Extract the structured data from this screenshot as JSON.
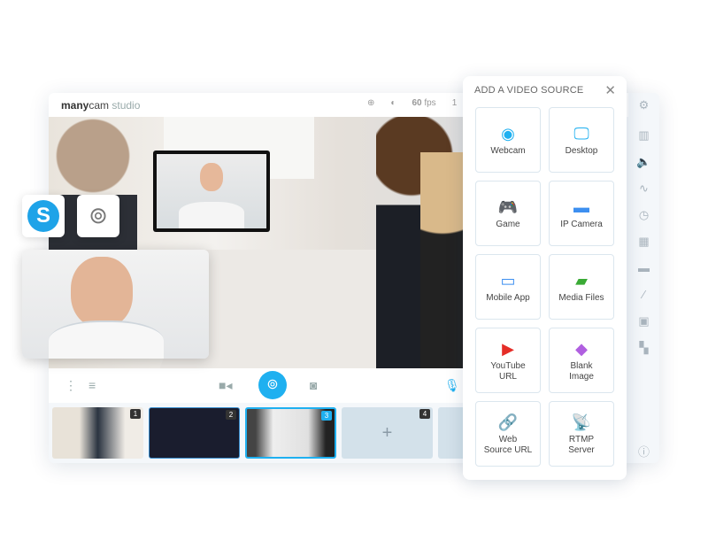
{
  "app": {
    "brand_bold": "many",
    "brand_light": "cam",
    "product": " studio",
    "fps_value": "60",
    "fps_unit": " fps",
    "extra": "1"
  },
  "header_icons": [
    "zoom-in-icon",
    "brightness-icon"
  ],
  "controls": {
    "left": [
      "more-vertical-icon",
      "playlist-icon"
    ],
    "center": [
      "video-camera-icon",
      "broadcast-icon",
      "camera-snapshot-icon"
    ],
    "right": [
      "microphone-icon"
    ]
  },
  "thumbnails": [
    {
      "number": "1",
      "content": "photo"
    },
    {
      "number": "2",
      "content": "dashboard"
    },
    {
      "number": "3",
      "content": "meeting",
      "active": true
    },
    {
      "number": "4",
      "content": "empty",
      "symbol": "+"
    }
  ],
  "sidebar_icons": [
    "settings-icon",
    "presets-icon",
    "audio-icon",
    "drawing-icon",
    "clock-icon",
    "chroma-key-icon",
    "lower-third-icon",
    "effects-icon",
    "gallery-icon",
    "widgets-icon",
    "info-icon"
  ],
  "overlay_badges": [
    "skype-icon",
    "broadcast-icon"
  ],
  "panel": {
    "title": "ADD A VIDEO SOURCE",
    "close": "✕",
    "sources": [
      {
        "label": "Webcam",
        "icon": "webcam-icon",
        "color": "#1fb0f0"
      },
      {
        "label": "Desktop",
        "icon": "desktop-icon",
        "color": "#1fb0f0"
      },
      {
        "label": "Game",
        "icon": "gamepad-icon",
        "color": "#f5a623"
      },
      {
        "label": "IP Camera",
        "icon": "ip-camera-icon",
        "color": "#3d8ff0"
      },
      {
        "label": "Mobile App",
        "icon": "mobile-app-icon",
        "color": "#3d8ff0"
      },
      {
        "label": "Media Files",
        "icon": "image-icon",
        "color": "#3aaa35"
      },
      {
        "label": "YouTube URL",
        "line1": "YouTube",
        "line2": "URL",
        "icon": "youtube-icon",
        "color": "#e52d27"
      },
      {
        "label": "Blank Image",
        "line1": "Blank",
        "line2": "Image",
        "icon": "paint-bucket-icon",
        "color": "#b05fe0"
      },
      {
        "label": "Web Source URL",
        "line1": "Web",
        "line2": "Source URL",
        "icon": "link-icon",
        "color": "#3d8ff0"
      },
      {
        "label": "RTMP Server",
        "line1": "RTMP",
        "line2": "Server",
        "icon": "satellite-icon",
        "color": "#f26522"
      }
    ]
  },
  "colors": {
    "accent": "#1fb0f0",
    "thumb_active_border": "#1fb0f0"
  }
}
